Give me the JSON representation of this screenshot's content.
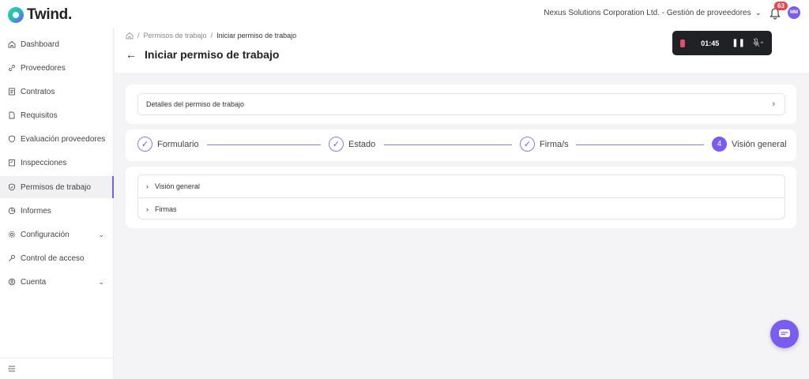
{
  "app": {
    "logo_text": "Twind."
  },
  "topbar": {
    "organization": "Nexus Solutions Corporation Ltd. - Gestión de proveedores",
    "notifications_count": "63",
    "avatar_initials": "MM"
  },
  "sidebar": {
    "items": [
      {
        "label": "Dashboard",
        "icon": "home-icon"
      },
      {
        "label": "Proveedores",
        "icon": "link-icon"
      },
      {
        "label": "Contratos",
        "icon": "document-icon"
      },
      {
        "label": "Requisitos",
        "icon": "file-icon"
      },
      {
        "label": "Evaluación proveedores",
        "icon": "shield-icon"
      },
      {
        "label": "Inspecciones",
        "icon": "clipboard-icon"
      },
      {
        "label": "Permisos de trabajo",
        "icon": "shield-check-icon",
        "active": true
      },
      {
        "label": "Informes",
        "icon": "pie-chart-icon"
      },
      {
        "label": "Configuración",
        "icon": "gear-icon",
        "expandable": true
      },
      {
        "label": "Control de acceso",
        "icon": "key-icon"
      },
      {
        "label": "Cuenta",
        "icon": "user-circle-icon",
        "expandable": true
      }
    ]
  },
  "breadcrumb": {
    "parent": "Permisos de trabajo",
    "current": "Iniciar permiso de trabajo"
  },
  "page": {
    "title": "Iniciar permiso de trabajo"
  },
  "recorder": {
    "time": "01:45"
  },
  "details": {
    "label": "Detalles del permiso de trabajo"
  },
  "stepper": {
    "steps": [
      {
        "label": "Formulario",
        "state": "done"
      },
      {
        "label": "Estado",
        "state": "done"
      },
      {
        "label": "Firma/s",
        "state": "done"
      },
      {
        "label": "Visión general",
        "state": "active",
        "number": "4"
      }
    ]
  },
  "sections": [
    {
      "label": "Visión general"
    },
    {
      "label": "Firmas"
    }
  ],
  "colors": {
    "accent": "#7b5cf0",
    "badge": "#e8464a",
    "recorder_bg": "#1f2125"
  }
}
